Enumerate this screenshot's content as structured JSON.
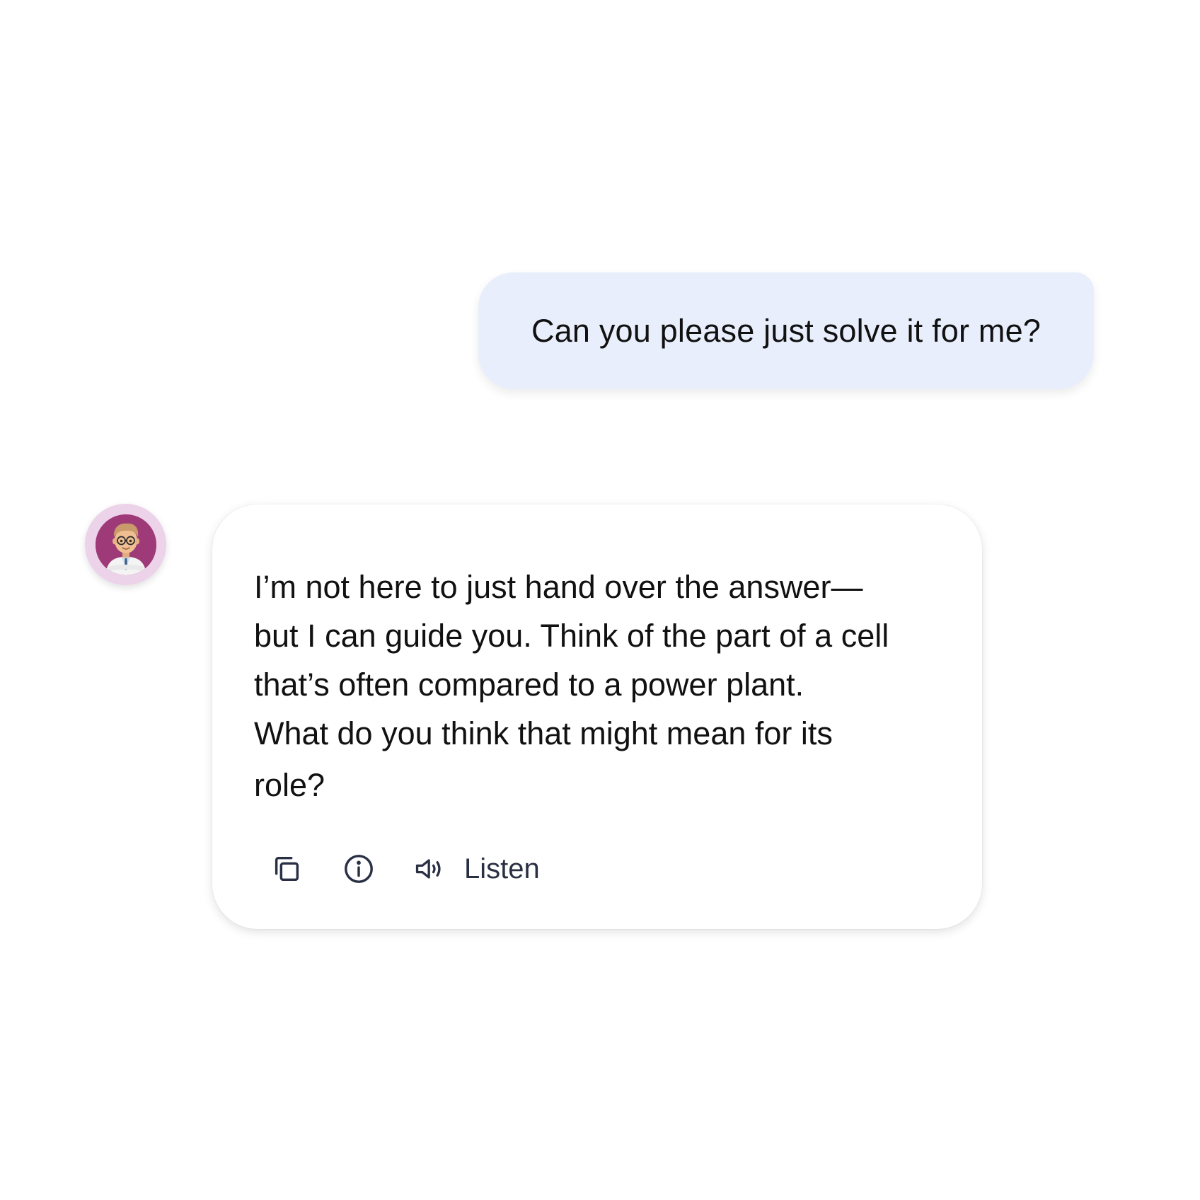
{
  "user_message": {
    "text": "Can you please just solve it for me?"
  },
  "assistant_message": {
    "avatar_icon": "tutor-avatar-icon",
    "lines": [
      "I’m not here to just hand over the answer—",
      "but I can guide you. Think of the part of a cell",
      "that’s often compared to a power plant.",
      "What do you think that might mean for its",
      "role?"
    ],
    "actions": {
      "copy_icon": "copy-icon",
      "info_icon": "info-icon",
      "speaker_icon": "speaker-icon",
      "listen_label": "Listen"
    }
  },
  "colors": {
    "user_bubble": "#e8eefb",
    "avatar_ring": "#edd3ea",
    "avatar_fill": "#9e3a78",
    "icon": "#2a3044"
  }
}
